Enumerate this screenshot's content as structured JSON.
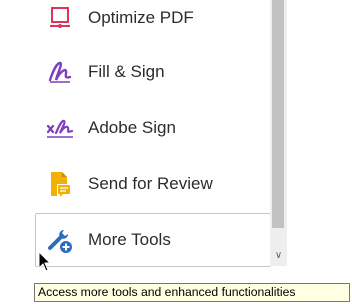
{
  "tools": [
    {
      "label": "Optimize PDF",
      "icon": "optimize-pdf-icon",
      "color": "#e0335a"
    },
    {
      "label": "Fill & Sign",
      "icon": "fill-sign-icon",
      "color": "#7b3fbf"
    },
    {
      "label": "Adobe Sign",
      "icon": "adobe-sign-icon",
      "color": "#7b3fbf"
    },
    {
      "label": "Send for Review",
      "icon": "send-for-review-icon",
      "color": "#f2b100"
    },
    {
      "label": "More Tools",
      "icon": "more-tools-icon",
      "color": "#2a6ebb"
    }
  ],
  "tooltip": {
    "text": "Access more tools and enhanced functionalities"
  }
}
